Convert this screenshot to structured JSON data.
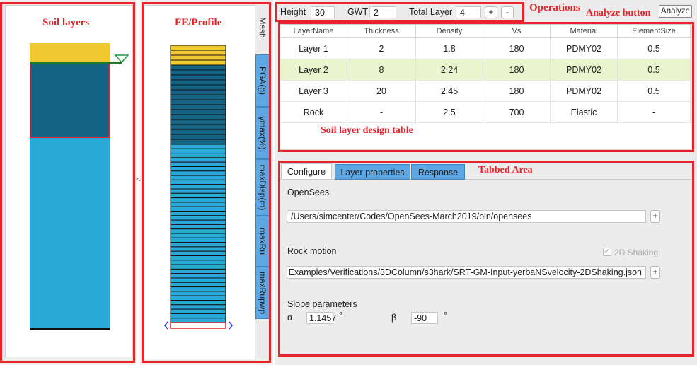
{
  "annotations": {
    "soil_layers": "Soil layers",
    "fe_profile": "FE/Profile",
    "operations": "Operations",
    "analyze_button": "Analyze button",
    "design_table": "Soil layer design table",
    "tabbed_area": "Tabbed Area"
  },
  "toolbar": {
    "height_label": "Height",
    "height_value": "30",
    "gwt_label": "GWT",
    "gwt_value": "2",
    "total_layer_label": "Total Layer",
    "total_layer_value": "4",
    "add": "+",
    "remove": "-",
    "analyze": "Analyze"
  },
  "side_tabs": {
    "mesh": "Mesh",
    "items": [
      "PGA(g)",
      "γmax(%)",
      "maxDisp(m)",
      "maxRu",
      "maxRupwp"
    ]
  },
  "splitter_glyph": "<",
  "table": {
    "headers": [
      "LayerName",
      "Thickness",
      "Density",
      "Vs",
      "Material",
      "ElementSize"
    ],
    "rows": [
      [
        "Layer 1",
        "2",
        "1.8",
        "180",
        "PDMY02",
        "0.5"
      ],
      [
        "Layer 2",
        "8",
        "2.24",
        "180",
        "PDMY02",
        "0.5"
      ],
      [
        "Layer 3",
        "20",
        "2.45",
        "180",
        "PDMY02",
        "0.5"
      ],
      [
        "Rock",
        "-",
        "2.5",
        "700",
        "Elastic",
        "-"
      ]
    ],
    "highlight_row": 1
  },
  "tabs": {
    "items": [
      "Configure",
      "Layer properties",
      "Response"
    ],
    "active": 0
  },
  "configure": {
    "opensees_label": "OpenSees",
    "opensees_path": "/Users/simcenter/Codes/OpenSees-March2019/bin/opensees",
    "rock_motion_label": "Rock motion",
    "shaking_2d_label": "2D Shaking",
    "shaking_2d_checked": true,
    "rock_motion_path": "Examples/Verifications/3DColumn/s3hark/SRT-GM-Input-yerbaNSvelocity-2DShaking.json",
    "slope_label": "Slope parameters",
    "alpha_label": "α",
    "alpha_value": "1.1457",
    "alpha_unit": "°",
    "beta_label": "β",
    "beta_value": "-90",
    "beta_unit": "°",
    "browse": "+"
  },
  "colors": {
    "annotation_red": "#e8232a",
    "top_layer": "#f0c930",
    "layer2": "#156486",
    "layer3": "#29a9d6",
    "tab_blue": "#5da7e4",
    "row_highlight": "#eaf5cf"
  }
}
